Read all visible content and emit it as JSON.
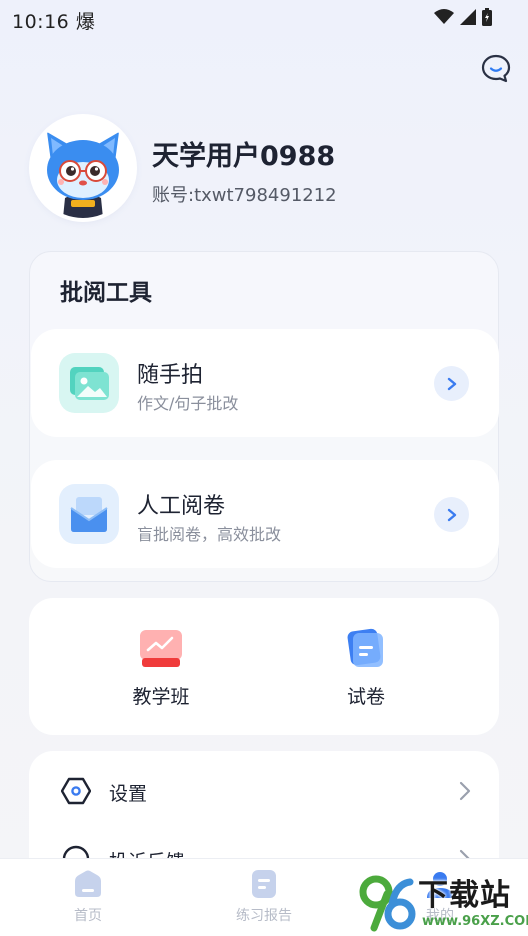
{
  "status_bar": {
    "time": "10:16",
    "extra_glyph": "爆"
  },
  "header": {
    "chat_icon": "chat-bubble-icon"
  },
  "profile": {
    "username": "天学用户0988",
    "account": "账号:txwt798491212"
  },
  "tools": {
    "title": "批阅工具",
    "items": [
      {
        "name": "随手拍",
        "desc": "作文/句子批改",
        "icon": "photo-icon"
      },
      {
        "name": "人工阅卷",
        "desc": "盲批阅卷，高效批改",
        "icon": "mail-icon"
      }
    ]
  },
  "quick": {
    "items": [
      {
        "label": "教学班",
        "icon": "chart-board-icon"
      },
      {
        "label": "试卷",
        "icon": "paper-icon"
      }
    ]
  },
  "menu": {
    "items": [
      {
        "label": "设置",
        "icon": "settings-hexagon-icon"
      },
      {
        "label": "投诉反馈",
        "icon": "feedback-icon"
      }
    ]
  },
  "bottom_nav": {
    "items": [
      {
        "label": "首页",
        "icon": "home-icon"
      },
      {
        "label": "练习报告",
        "icon": "report-icon"
      },
      {
        "label": "我的",
        "icon": "profile-icon"
      }
    ]
  },
  "watermark": {
    "title": "下载站",
    "url": "www.96XZ.COM",
    "logo": "96"
  },
  "colors": {
    "accent": "#3a7bf0",
    "text": "#1e2332",
    "subtext": "#8a8f9c"
  }
}
